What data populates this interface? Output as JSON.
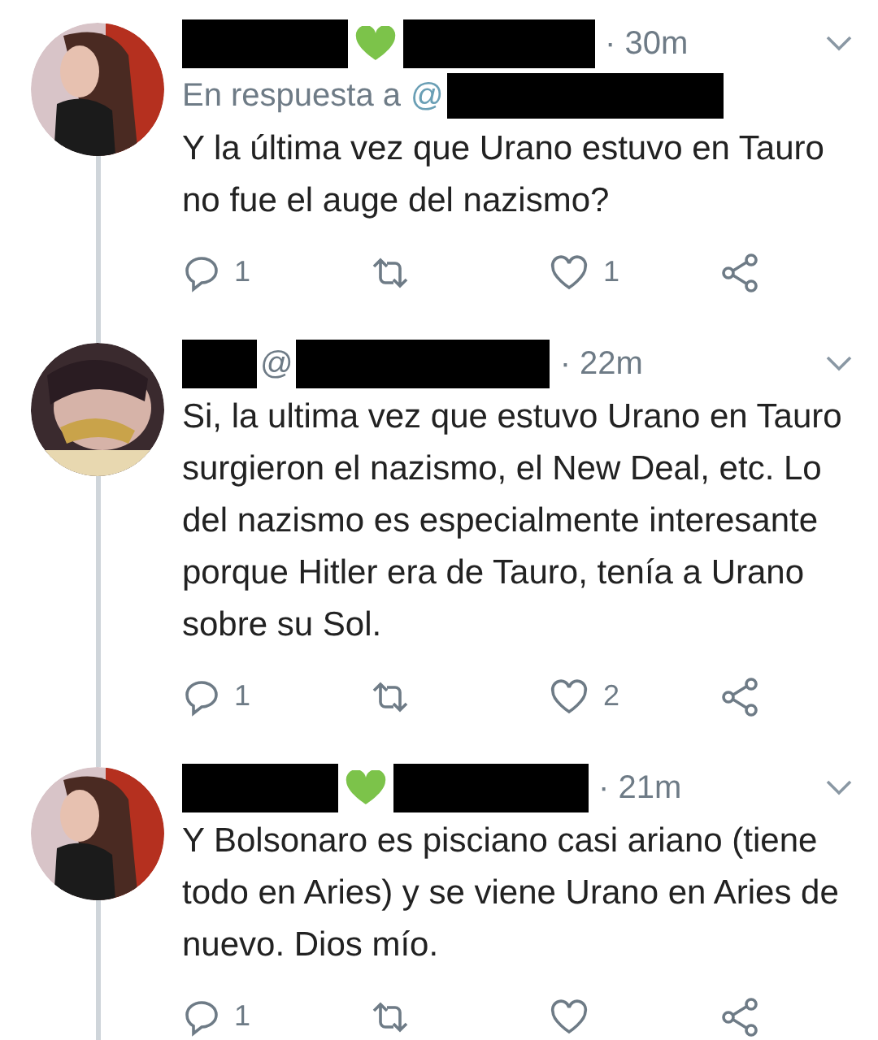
{
  "tweets": [
    {
      "header": [
        {
          "kind": "redaction"
        },
        {
          "kind": "heart"
        },
        {
          "kind": "redaction"
        }
      ],
      "time": "· 30m",
      "reply_to": {
        "label": "En respuesta a",
        "handle": "@"
      },
      "text": "Y la última vez que Urano estuvo en Tauro no fue el auge del nazismo?",
      "actions": {
        "replies": "1",
        "likes": "1"
      }
    },
    {
      "header": [
        {
          "kind": "redaction"
        },
        {
          "kind": "text",
          "text": "@"
        },
        {
          "kind": "redaction"
        }
      ],
      "time": "· 22m",
      "text": "Si, la ultima vez que estuvo Urano en Tauro surgieron el nazismo, el New Deal, etc. Lo del nazismo es especialmente interesante porque Hitler era de Tauro, tenía a Urano sobre su Sol.",
      "actions": {
        "replies": "1",
        "likes": "2"
      }
    },
    {
      "header": [
        {
          "kind": "redaction"
        },
        {
          "kind": "heart"
        },
        {
          "kind": "redaction"
        }
      ],
      "time": "· 21m",
      "text": "Y Bolsonaro es pisciano casi ariano (tiene todo en Aries) y se viene Urano en Aries de nuevo. Dios mío.",
      "actions": {
        "replies": "1"
      }
    }
  ]
}
